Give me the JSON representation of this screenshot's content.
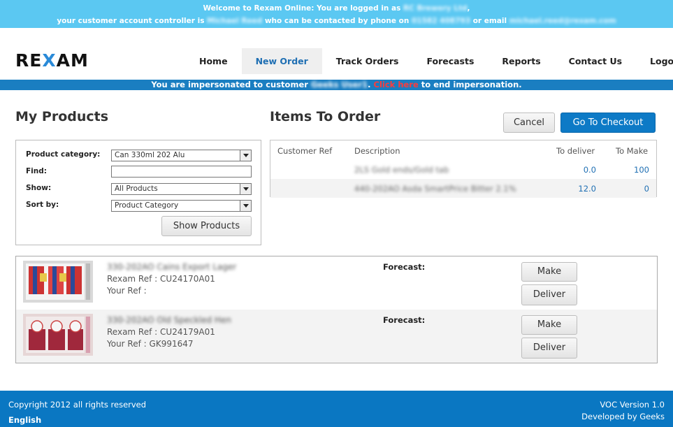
{
  "banner": {
    "line1_prefix": "Welcome to Rexam Online: You are logged in as",
    "line1_user": "RC Brewery Ltd",
    "line2_prefix": "your customer account controller is",
    "controller": "Michael Reed",
    "line2_mid": "who can be contacted by phone on",
    "phone": "01582 408793",
    "line2_or": "or email",
    "email": "michael.reed@rexam.com"
  },
  "logo": {
    "part1": "RE",
    "part2": "X",
    "part3": "AM"
  },
  "nav": [
    {
      "label": "Home"
    },
    {
      "label": "New Order",
      "active": true
    },
    {
      "label": "Track Orders"
    },
    {
      "label": "Forecasts"
    },
    {
      "label": "Reports"
    },
    {
      "label": "Contact Us"
    },
    {
      "label": "Logout"
    }
  ],
  "impersonation": {
    "prefix": "You are impersonated to customer",
    "customer": "Geeks User1",
    "dot": ".",
    "link": "Click here",
    "suffix": "to end impersonation."
  },
  "my_products": {
    "title": "My Products",
    "category_label": "Product category:",
    "category_value": "Can 330ml 202 Alu",
    "find_label": "Find:",
    "find_value": "",
    "show_label": "Show:",
    "show_value": "All Products",
    "sort_label": "Sort by:",
    "sort_value": "Product Category",
    "show_button": "Show Products"
  },
  "items_to_order": {
    "title": "Items To Order",
    "cancel_button": "Cancel",
    "checkout_button": "Go To Checkout",
    "columns": [
      "Customer Ref",
      "Description",
      "To deliver",
      "To Make"
    ],
    "rows": [
      {
        "customer_ref": "",
        "description": "2LS Gold ends/Gold tab",
        "to_deliver": "0.0",
        "to_make": "100"
      },
      {
        "customer_ref": "",
        "description": "440-202AO Asda SmartPrice Bitter 2.1%",
        "to_deliver": "12.0",
        "to_make": "0"
      }
    ]
  },
  "products": [
    {
      "name": "330-202AO Cains Export Lager",
      "rexam_ref_label": "Rexam Ref :",
      "rexam_ref": "CU24170A01",
      "your_ref_label": "Your Ref :",
      "your_ref": "",
      "forecast_label": "Forecast:",
      "make_button": "Make",
      "deliver_button": "Deliver"
    },
    {
      "name": "330-202AO Old Speckled Hen",
      "rexam_ref_label": "Rexam Ref :",
      "rexam_ref": "CU24179A01",
      "your_ref_label": "Your Ref :",
      "your_ref": "GK991647",
      "forecast_label": "Forecast:",
      "make_button": "Make",
      "deliver_button": "Deliver"
    }
  ],
  "footer": {
    "copyright": "Copyright 2012 all rights reserved",
    "language": "English",
    "version": "VOC Version 1.0",
    "developer": "Developed by Geeks"
  },
  "colors": {
    "banner": "#5bc8f2",
    "impersonation_bar": "#1a7ec1",
    "primary_button": "#0d7ac6",
    "footer": "#0a77c2",
    "link_red": "#ff3b3b"
  }
}
